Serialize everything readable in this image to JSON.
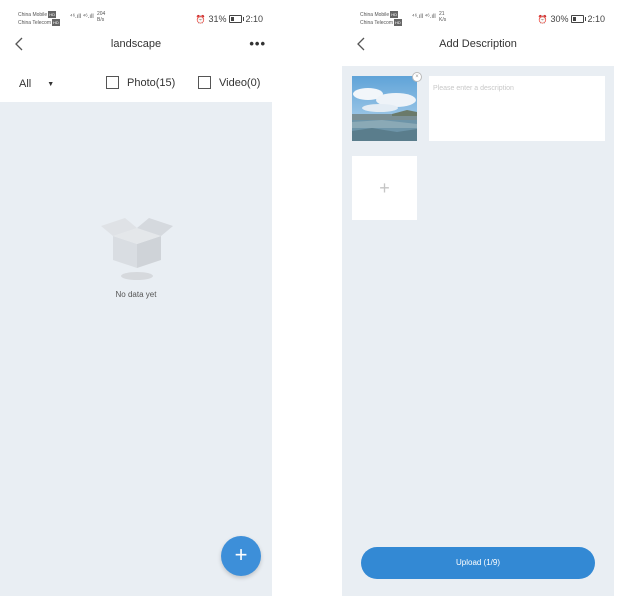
{
  "colors": {
    "content_background": "#e9eef3",
    "accent_blue": "#3d8fd9",
    "upload_button": "#3389d4"
  },
  "left_screen": {
    "status_bar": {
      "carrier_1": "China Mobile",
      "carrier_2": "China Telecom",
      "carrier_badge": "HD",
      "signal": "⁴⁶.ıll ⁴⁶.ıll",
      "speed_value": "204",
      "speed_unit": "B/s",
      "battery": "31%",
      "time": "2:10"
    },
    "header": {
      "title": "landscape",
      "back_icon": "chevron-left-icon",
      "more_icon": "more-dots-icon",
      "more_label": "•••"
    },
    "filters": {
      "dropdown_label": "All",
      "dropdown_caret": "▼",
      "photo_label": "Photo(15)",
      "video_label": "Video(0)"
    },
    "empty_state": {
      "icon": "empty-box-icon",
      "text": "No data yet"
    },
    "fab": {
      "icon": "plus-icon",
      "label": "+"
    }
  },
  "right_screen": {
    "status_bar": {
      "carrier_1": "China Mobile",
      "carrier_2": "China Telecom",
      "carrier_badge": "HD",
      "signal": "⁴⁶.ıll ⁴⁶.ıll",
      "speed_value": "21",
      "speed_unit": "K/s",
      "battery": "30%",
      "time": "2:10"
    },
    "header": {
      "title": "Add Description",
      "back_icon": "chevron-left-icon"
    },
    "photo": {
      "icon": "landscape-thumbnail",
      "remove_label": "×"
    },
    "description": {
      "placeholder": "Please enter a description"
    },
    "add_tile": {
      "icon": "plus-icon",
      "label": "+"
    },
    "upload_button": {
      "label": "Upload (1/9)"
    }
  }
}
